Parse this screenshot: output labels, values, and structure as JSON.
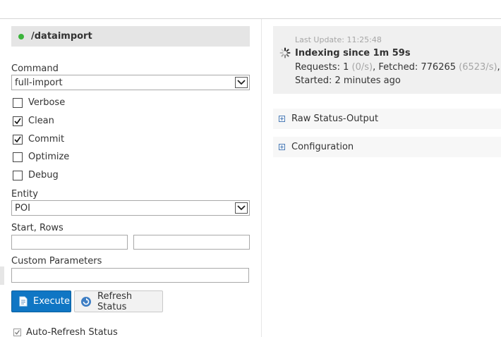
{
  "header": {
    "title": "/dataimport",
    "status_color": "#3cb43c"
  },
  "form": {
    "command_label": "Command",
    "command_value": "full-import",
    "options": [
      {
        "label": "Verbose",
        "checked": false
      },
      {
        "label": "Clean",
        "checked": true
      },
      {
        "label": "Commit",
        "checked": true
      },
      {
        "label": "Optimize",
        "checked": false
      },
      {
        "label": "Debug",
        "checked": false
      }
    ],
    "entity_label": "Entity",
    "entity_value": "POI",
    "start_rows_label": "Start, Rows",
    "start_value": "",
    "rows_value": "",
    "custom_params_label": "Custom Parameters",
    "custom_params_value": ""
  },
  "buttons": {
    "execute_label": "Execute",
    "refresh_label": "Refresh Status",
    "execute_color": "#0f76c4"
  },
  "auto_refresh": {
    "label": "Auto-Refresh Status",
    "checked": true
  },
  "status": {
    "last_update": "Last Update: 11:25:48",
    "indexing": "Indexing since 1m 59s",
    "requests_label": "Requests: ",
    "requests_count": "1",
    "requests_rate": "(0/s)",
    "fetched_label": ", Fetched: ",
    "fetched_count": "776265",
    "fetched_rate": "(6523/s)",
    "trailing": ", S",
    "started": "Started: 2 minutes ago"
  },
  "sections": {
    "raw_status": "Raw Status-Output",
    "configuration": "Configuration"
  }
}
